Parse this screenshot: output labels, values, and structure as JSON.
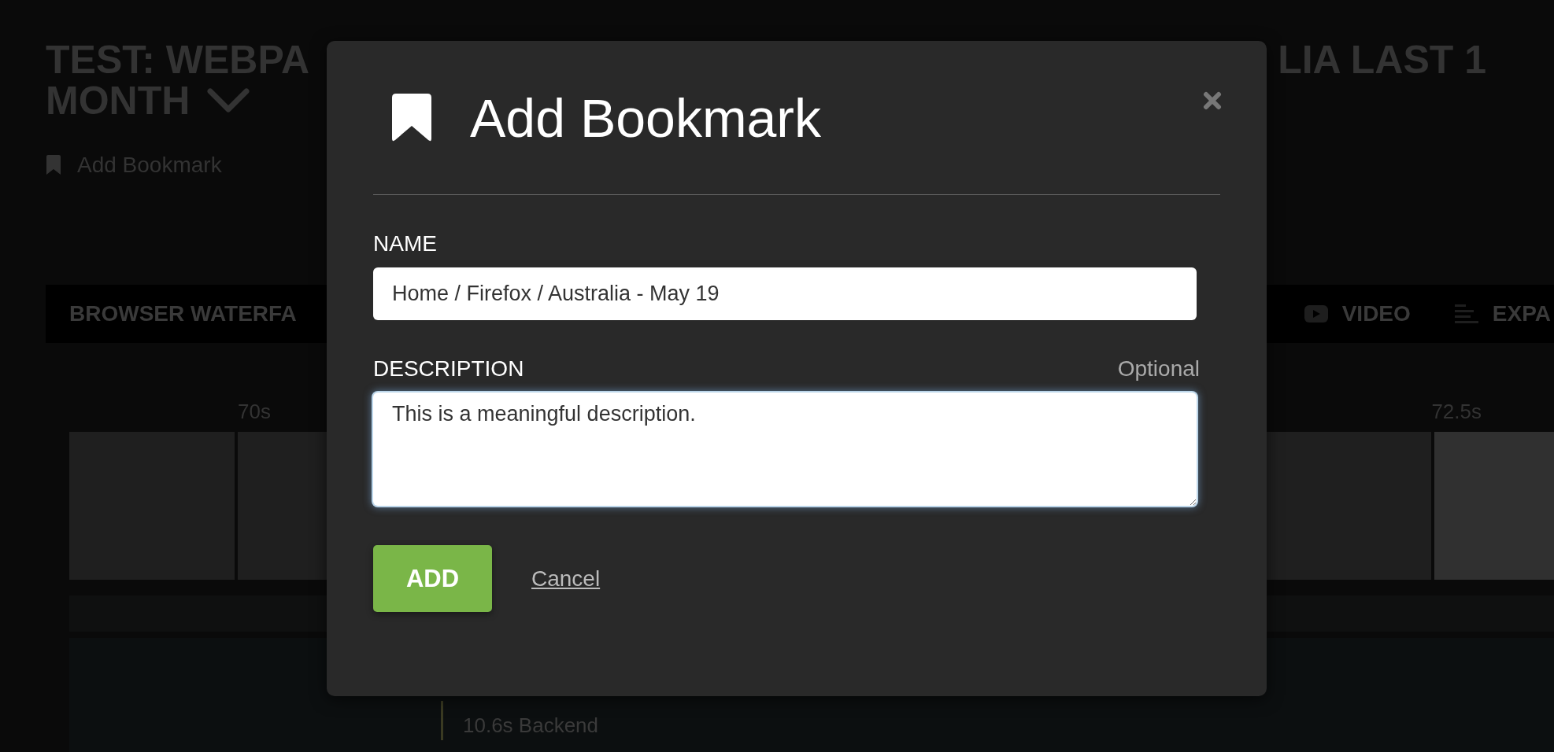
{
  "page_title": {
    "line_1_left": "TEST: WEBPA",
    "line_1_right": "LIA LAST 1",
    "line_2": "MONTH"
  },
  "bookmark_link": "Add Bookmark",
  "toolbar": {
    "tabs": [
      {
        "label": "BROWSER WATERFA",
        "kind": "plain"
      },
      {
        "label": "VIDEO",
        "kind": "video"
      },
      {
        "label": "EXPA",
        "kind": "lines"
      }
    ]
  },
  "timeline": {
    "ticks": [
      "70s",
      "72.5s"
    ],
    "marker_label": "10.6s Backend"
  },
  "dialog": {
    "title": "Add Bookmark",
    "fields": [
      {
        "kind": "input",
        "label": "NAME",
        "value": "Home / Firefox / Australia - May 19",
        "focused": false
      },
      {
        "kind": "textarea",
        "label": "DESCRIPTION",
        "hint": "Optional",
        "value": "This is a meaningful description.",
        "focused": true
      }
    ],
    "primary_button": "ADD",
    "secondary_link": "Cancel"
  }
}
